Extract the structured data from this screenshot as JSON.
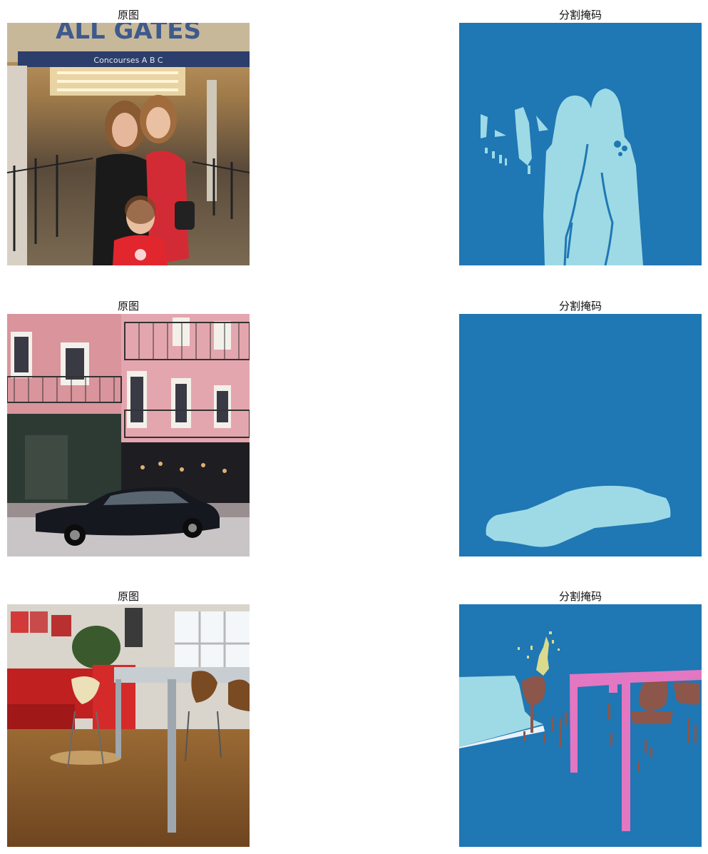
{
  "figure": {
    "panels": [
      {
        "row": 1,
        "kind": "photo",
        "title": "原图",
        "image_text": [
          "ALL GATES",
          "Concourses A B C"
        ]
      },
      {
        "row": 1,
        "kind": "mask",
        "title": "分割掩码"
      },
      {
        "row": 2,
        "kind": "photo",
        "title": "原图"
      },
      {
        "row": 2,
        "kind": "mask",
        "title": "分割掩码"
      },
      {
        "row": 3,
        "kind": "photo",
        "title": "原图"
      },
      {
        "row": 3,
        "kind": "mask",
        "title": "分割掩码"
      }
    ],
    "mask_colors": {
      "background": "#1f77b4",
      "class_light_blue": "#9edae5",
      "class_brown": "#8c564b",
      "class_pink": "#e377c2",
      "class_yellow": "#dbdb8d"
    }
  }
}
